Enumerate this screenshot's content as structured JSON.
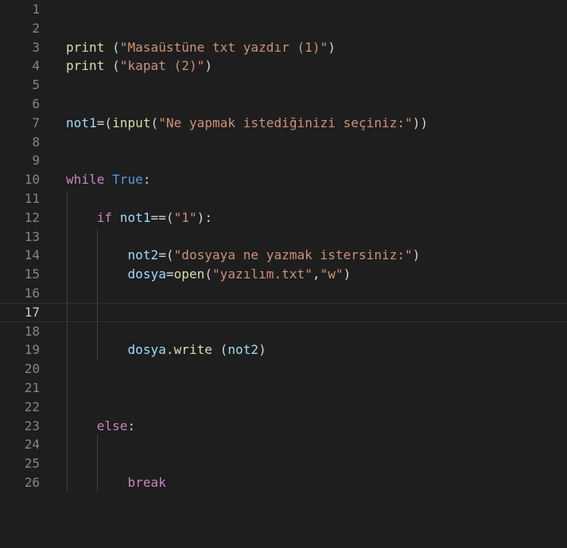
{
  "editor": {
    "current_line": "17",
    "lines": [
      {
        "n": "1",
        "tokens": []
      },
      {
        "n": "2",
        "tokens": []
      },
      {
        "n": "3",
        "tokens": [
          {
            "t": "print",
            "c": "fn"
          },
          {
            "t": " (",
            "c": "punc"
          },
          {
            "t": "\"Masaüstüne txt yazdır (1)\"",
            "c": "str"
          },
          {
            "t": ")",
            "c": "punc"
          }
        ]
      },
      {
        "n": "4",
        "tokens": [
          {
            "t": "print",
            "c": "fn"
          },
          {
            "t": " (",
            "c": "punc"
          },
          {
            "t": "\"kapat (2)\"",
            "c": "str"
          },
          {
            "t": ")",
            "c": "punc"
          }
        ]
      },
      {
        "n": "5",
        "tokens": []
      },
      {
        "n": "6",
        "tokens": []
      },
      {
        "n": "7",
        "tokens": [
          {
            "t": "not1",
            "c": "var"
          },
          {
            "t": "=(",
            "c": "punc"
          },
          {
            "t": "input",
            "c": "fn"
          },
          {
            "t": "(",
            "c": "punc"
          },
          {
            "t": "\"Ne yapmak istediğinizi seçiniz:\"",
            "c": "str"
          },
          {
            "t": "))",
            "c": "punc"
          }
        ]
      },
      {
        "n": "8",
        "tokens": []
      },
      {
        "n": "9",
        "tokens": []
      },
      {
        "n": "10",
        "tokens": [
          {
            "t": "while",
            "c": "kw"
          },
          {
            "t": " ",
            "c": "punc"
          },
          {
            "t": "True",
            "c": "const"
          },
          {
            "t": ":",
            "c": "punc"
          }
        ]
      },
      {
        "n": "11",
        "tokens": []
      },
      {
        "n": "12",
        "tokens": [
          {
            "t": "    ",
            "c": "punc"
          },
          {
            "t": "if",
            "c": "kw"
          },
          {
            "t": " ",
            "c": "punc"
          },
          {
            "t": "not1",
            "c": "var"
          },
          {
            "t": "==(",
            "c": "punc"
          },
          {
            "t": "\"1\"",
            "c": "str"
          },
          {
            "t": "):",
            "c": "punc"
          }
        ]
      },
      {
        "n": "13",
        "tokens": []
      },
      {
        "n": "14",
        "tokens": [
          {
            "t": "        ",
            "c": "punc"
          },
          {
            "t": "not2",
            "c": "var"
          },
          {
            "t": "=(",
            "c": "punc"
          },
          {
            "t": "\"dosyaya ne yazmak istersiniz:\"",
            "c": "str"
          },
          {
            "t": ")",
            "c": "punc"
          }
        ]
      },
      {
        "n": "15",
        "tokens": [
          {
            "t": "        ",
            "c": "punc"
          },
          {
            "t": "dosya",
            "c": "var"
          },
          {
            "t": "=",
            "c": "punc"
          },
          {
            "t": "open",
            "c": "fn"
          },
          {
            "t": "(",
            "c": "punc"
          },
          {
            "t": "\"yazılım.txt\"",
            "c": "str"
          },
          {
            "t": ",",
            "c": "punc"
          },
          {
            "t": "\"w\"",
            "c": "str"
          },
          {
            "t": ")",
            "c": "punc"
          }
        ]
      },
      {
        "n": "16",
        "tokens": []
      },
      {
        "n": "17",
        "tokens": []
      },
      {
        "n": "18",
        "tokens": []
      },
      {
        "n": "19",
        "tokens": [
          {
            "t": "        ",
            "c": "punc"
          },
          {
            "t": "dosya",
            "c": "var"
          },
          {
            "t": ".",
            "c": "punc"
          },
          {
            "t": "write",
            "c": "fn"
          },
          {
            "t": " (",
            "c": "punc"
          },
          {
            "t": "not2",
            "c": "var"
          },
          {
            "t": ")",
            "c": "punc"
          }
        ]
      },
      {
        "n": "20",
        "tokens": []
      },
      {
        "n": "21",
        "tokens": []
      },
      {
        "n": "22",
        "tokens": []
      },
      {
        "n": "23",
        "tokens": [
          {
            "t": "    ",
            "c": "punc"
          },
          {
            "t": "else",
            "c": "kw"
          },
          {
            "t": ":",
            "c": "punc"
          }
        ]
      },
      {
        "n": "24",
        "tokens": []
      },
      {
        "n": "25",
        "tokens": []
      },
      {
        "n": "26",
        "tokens": [
          {
            "t": "        ",
            "c": "punc"
          },
          {
            "t": "break",
            "c": "kw"
          }
        ]
      }
    ]
  },
  "colors": {
    "background": "#1e1e1e",
    "line_number": "#858585",
    "function": "#dcdcaa",
    "string": "#ce9178",
    "variable": "#9cdcfe",
    "keyword": "#c586c0",
    "constant": "#569cd6"
  }
}
